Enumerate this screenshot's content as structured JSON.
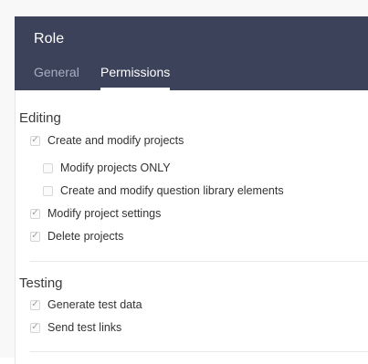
{
  "header": {
    "title": "Role",
    "tabs": [
      {
        "label": "General",
        "active": false
      },
      {
        "label": "Permissions",
        "active": true
      }
    ]
  },
  "sections": {
    "editing": {
      "title": "Editing",
      "items": [
        {
          "label": "Create and modify projects",
          "checked": true
        },
        {
          "label": "Modify projects ONLY",
          "checked": false
        },
        {
          "label": "Create and modify question library elements",
          "checked": false
        },
        {
          "label": "Modify project settings",
          "checked": true
        },
        {
          "label": "Delete projects",
          "checked": true
        }
      ]
    },
    "testing": {
      "title": "Testing",
      "items": [
        {
          "label": "Generate test data",
          "checked": true
        },
        {
          "label": "Send test links",
          "checked": true
        }
      ]
    }
  },
  "colors": {
    "header_bg": "#3c4259",
    "tab_inactive": "#a8aec2",
    "tab_active": "#ffffff"
  }
}
